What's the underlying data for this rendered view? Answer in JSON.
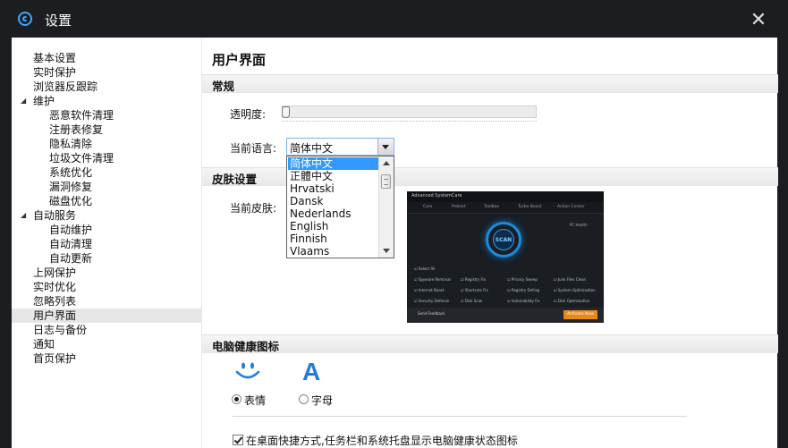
{
  "window": {
    "title": "设置"
  },
  "sidebar": {
    "items": [
      {
        "label": "基本设置",
        "level": 0
      },
      {
        "label": "实时保护",
        "level": 0
      },
      {
        "label": "浏览器反跟踪",
        "level": 0
      },
      {
        "label": "维护",
        "level": 0,
        "expanded": true
      },
      {
        "label": "恶意软件清理",
        "level": 1
      },
      {
        "label": "注册表修复",
        "level": 1
      },
      {
        "label": "隐私清除",
        "level": 1
      },
      {
        "label": "垃圾文件清理",
        "level": 1
      },
      {
        "label": "系统优化",
        "level": 1
      },
      {
        "label": "漏洞修复",
        "level": 1
      },
      {
        "label": "磁盘优化",
        "level": 1
      },
      {
        "label": "自动服务",
        "level": 0,
        "expanded": true
      },
      {
        "label": "自动维护",
        "level": 1
      },
      {
        "label": "自动清理",
        "level": 1
      },
      {
        "label": "自动更新",
        "level": 1
      },
      {
        "label": "上网保护",
        "level": 0
      },
      {
        "label": "实时优化",
        "level": 0
      },
      {
        "label": "忽略列表",
        "level": 0
      },
      {
        "label": "用户界面",
        "level": 0,
        "selected": true
      },
      {
        "label": "日志与备份",
        "level": 0
      },
      {
        "label": "通知",
        "level": 0
      },
      {
        "label": "首页保护",
        "level": 0
      }
    ]
  },
  "main": {
    "page_title": "用户界面",
    "general": {
      "header": "常规",
      "transparency_label": "透明度:",
      "transparency_value": 0,
      "language_label": "当前语言:",
      "language_value": "简体中文",
      "language_options": [
        "简体中文",
        "正體中文",
        "Hrvatski",
        "Dansk",
        "Nederlands",
        "English",
        "Finnish",
        "Vlaams"
      ]
    },
    "skin": {
      "header": "皮肤设置",
      "current_label": "当前皮肤:"
    },
    "health_icon": {
      "header": "电脑健康图标",
      "options": [
        {
          "label": "表情",
          "icon": "smiley-face-icon",
          "selected": true
        },
        {
          "label": "字母",
          "icon": "letter-a-icon",
          "selected": false
        }
      ],
      "letter_glyph": "A",
      "checkbox_label": "在桌面快捷方式,任务栏和系统托盘显示电脑健康状态图标",
      "checkbox_checked": true
    }
  },
  "colors": {
    "titlebar": "#1b1d20",
    "accent": "#1e7be0",
    "dropdown_selected": "#3399ff",
    "activate_button": "#e8891a"
  }
}
